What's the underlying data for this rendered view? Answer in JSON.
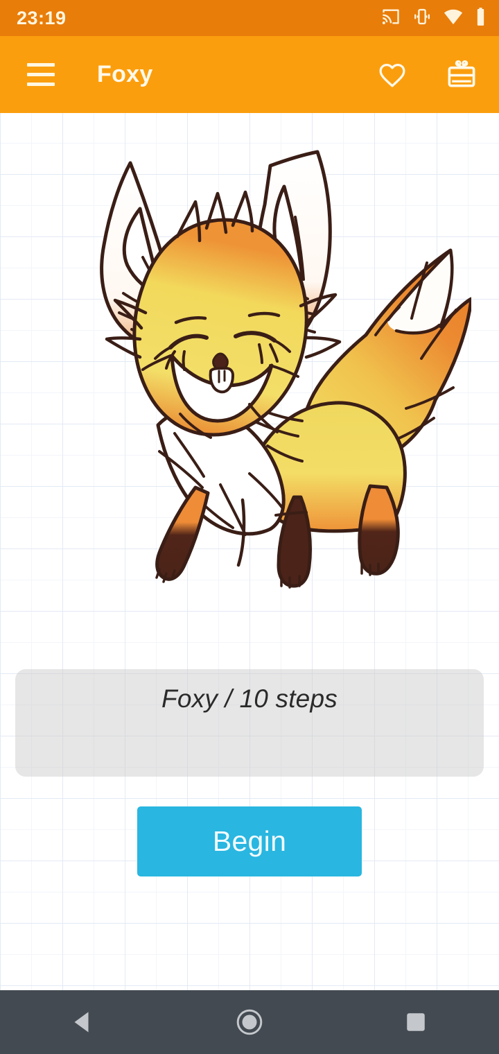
{
  "status_bar": {
    "time": "23:19",
    "background": "#E87D0A",
    "foreground": "#FFF6E0",
    "icons": [
      {
        "name": "cast-icon",
        "label": "Cast"
      },
      {
        "name": "vibrate-icon",
        "label": "Vibrate"
      },
      {
        "name": "wifi-icon",
        "label": "Wi-Fi"
      },
      {
        "name": "battery-icon",
        "label": "Battery"
      }
    ]
  },
  "app_bar": {
    "title": "Foxy",
    "background": "#FB9E0D",
    "foreground": "#FFF9EA",
    "menu_icon": "hamburger-menu-icon",
    "actions": [
      {
        "name": "favorite-icon",
        "label": "Favorite"
      },
      {
        "name": "gift-icon",
        "label": "Gift"
      }
    ]
  },
  "content": {
    "illustration": {
      "name": "fox-drawing",
      "subject": "Foxy",
      "colors": {
        "outline": "#3A1E16",
        "body_yellow": "#F2DC62",
        "body_orange": "#EE8C37",
        "paws_dark": "#4B2318",
        "white": "#FFFFFF"
      }
    },
    "grid": {
      "minor_color": "#F2F5FA",
      "major_color": "#E3EAF4",
      "minor_size": 45,
      "major_size": 90
    },
    "description": {
      "text": "Foxy / 10 steps",
      "background": "#C8C8C8"
    },
    "begin_button": {
      "label": "Begin",
      "background": "#29B6E0",
      "foreground": "#F2FCFF"
    }
  },
  "nav_bar": {
    "background": "#434A52",
    "foreground": "#C8CCD0",
    "buttons": [
      {
        "name": "nav-back-button",
        "label": "Back"
      },
      {
        "name": "nav-home-button",
        "label": "Home"
      },
      {
        "name": "nav-recents-button",
        "label": "Recents"
      }
    ]
  }
}
